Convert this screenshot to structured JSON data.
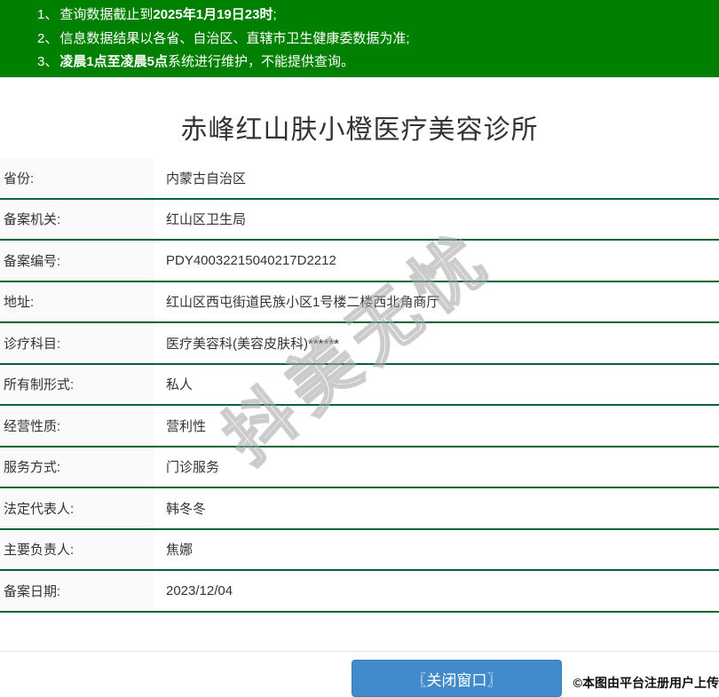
{
  "notice": {
    "lines": [
      {
        "num": "1、",
        "pre": "查询数据截止到",
        "bold": "2025年1月19日23时",
        "post": ";"
      },
      {
        "num": "2、",
        "pre": "信息数据结果以各省、自治区、直辖市卫生健康委数据为准;",
        "bold": "",
        "post": ""
      },
      {
        "num": "3、",
        "pre": "",
        "bold": "凌晨1点至凌晨5点",
        "post": "系统进行维护，不能提供查询。"
      }
    ]
  },
  "title": "赤峰红山肤小橙医疗美容诊所",
  "table": {
    "rows": [
      {
        "label": "省份:",
        "value": "内蒙古自治区"
      },
      {
        "label": "备案机关:",
        "value": "红山区卫生局"
      },
      {
        "label": "备案编号:",
        "value": "PDY40032215040217D2212"
      },
      {
        "label": "地址:",
        "value": "红山区西屯街道民族小区1号楼二楼西北角商厅"
      },
      {
        "label": "诊疗科目:",
        "value": "医疗美容科(美容皮肤科)******"
      },
      {
        "label": "所有制形式:",
        "value": "私人"
      },
      {
        "label": "经营性质:",
        "value": "营利性"
      },
      {
        "label": "服务方式:",
        "value": "门诊服务"
      },
      {
        "label": "法定代表人:",
        "value": "韩冬冬"
      },
      {
        "label": "主要负责人:",
        "value": "焦娜"
      },
      {
        "label": "备案日期:",
        "value": "2023/12/04"
      }
    ]
  },
  "watermark": {
    "text": "抖美无忧"
  },
  "footer": {
    "close_button_label": "〖关闭窗口〗",
    "attribution": "©本图由平台注册用户上传"
  },
  "colors": {
    "notice_bg": "#008000",
    "notice_text": "#ffffff",
    "row_divider_green": "#006633",
    "label_column_bg": "#fafafa",
    "button_blue": "#428bca",
    "text": "#333333"
  }
}
